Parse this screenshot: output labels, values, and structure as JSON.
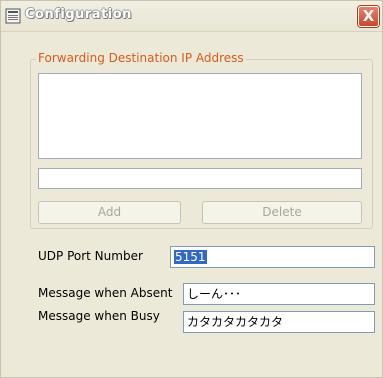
{
  "window": {
    "title": "Configuration",
    "close_label": "X"
  },
  "forwarding": {
    "group_label": "Forwarding Destination IP Address",
    "list_items": [],
    "ip_value": "",
    "add_label": "Add",
    "delete_label": "Delete"
  },
  "udp": {
    "label": "UDP Port Number",
    "value": "5151"
  },
  "absent": {
    "label": "Message when Absent",
    "value": "しーん･･･"
  },
  "busy": {
    "label": "Message when Busy",
    "value": "カタカタカタカタ"
  },
  "colors": {
    "group_label": "#d55d1f",
    "close_button": "#c9472b",
    "selection": "#316ac5"
  }
}
